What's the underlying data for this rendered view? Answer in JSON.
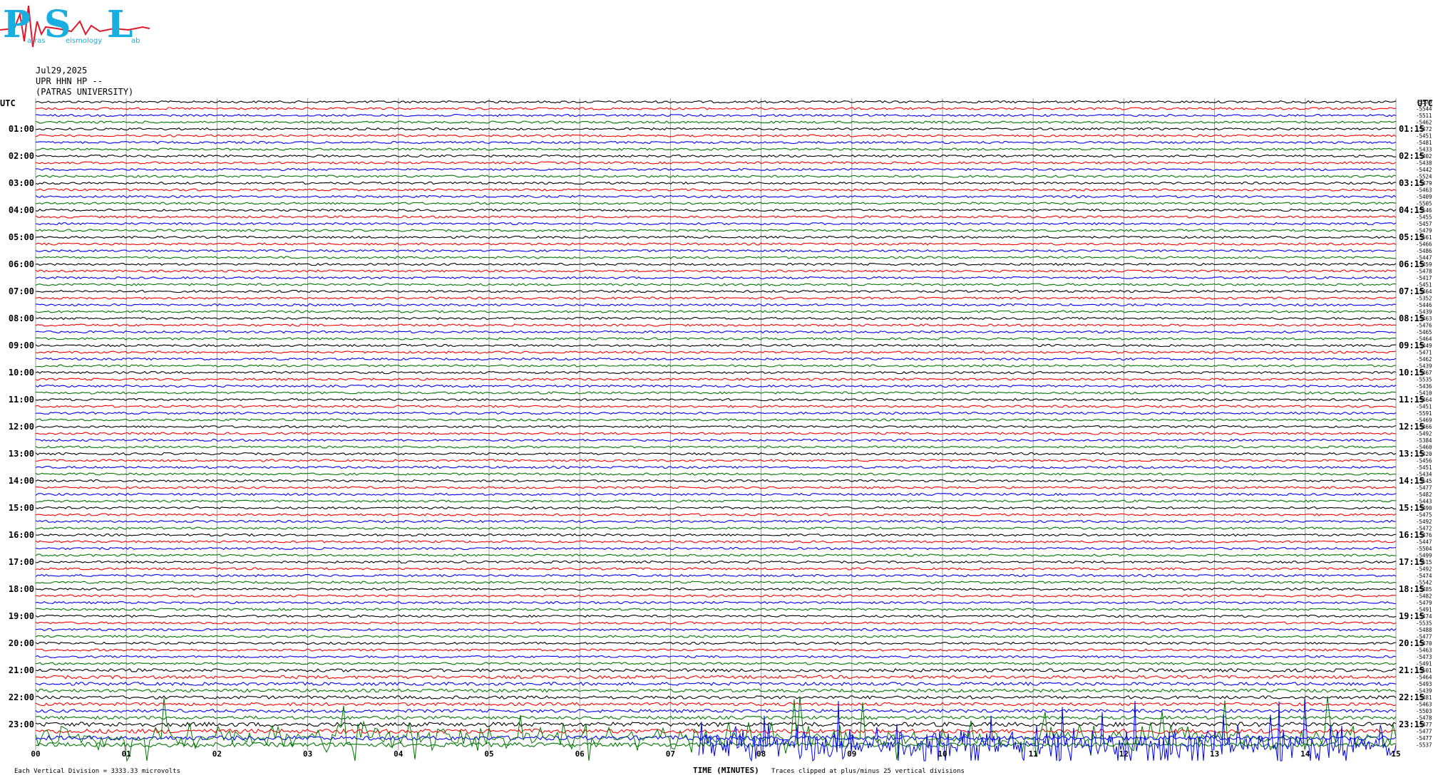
{
  "logo": {
    "letters": [
      "P",
      "S",
      "L"
    ],
    "words": [
      "atras",
      "eismology",
      "ab"
    ],
    "colors": {
      "main": "#19aee0",
      "trace": "#e0182b"
    }
  },
  "header": {
    "date": "Jul29,2025",
    "station": "UPR HHN HP --",
    "institution": "(PATRAS UNIVERSITY)"
  },
  "utc_label": "UTC",
  "left_time_labels": [
    "01:00",
    "02:00",
    "03:00",
    "04:00",
    "05:00",
    "06:00",
    "07:00",
    "08:00",
    "09:00",
    "10:00",
    "11:00",
    "12:00",
    "13:00",
    "14:00",
    "15:00",
    "16:00",
    "17:00",
    "18:00",
    "19:00",
    "20:00",
    "21:00",
    "22:00",
    "23:00"
  ],
  "right_time_labels": [
    "01:15",
    "02:15",
    "03:15",
    "04:15",
    "05:15",
    "06:15",
    "07:15",
    "08:15",
    "09:15",
    "10:15",
    "11:15",
    "12:15",
    "13:15",
    "14:15",
    "15:15",
    "16:15",
    "17:15",
    "18:15",
    "19:15",
    "20:15",
    "21:15",
    "22:15",
    "23:15"
  ],
  "minute_ticks": [
    "00",
    "01",
    "02",
    "03",
    "04",
    "05",
    "06",
    "07",
    "08",
    "09",
    "10",
    "11",
    "12",
    "13",
    "14",
    "15"
  ],
  "x_axis_label": "TIME (MINUTES)",
  "footer_left": "Each Vertical Division = 3333.33 microvolts",
  "footer_right": "Traces clipped at plus/minus 25 vertical divisions",
  "trace_colors": [
    "#000000",
    "#ff0000",
    "#0000ff",
    "#007700"
  ],
  "trace_offsets": [
    "-5579",
    "-5544",
    "-5511",
    "-5462",
    "-5472",
    "-5451",
    "-5481",
    "-5433",
    "-5402",
    "-5438",
    "-5442",
    "-5524",
    "-5479",
    "-5463",
    "-5409",
    "-5505",
    "-5546",
    "-5455",
    "-5457",
    "-5479",
    "-5561",
    "-5466",
    "-5486",
    "-5447",
    "-5459",
    "-5478",
    "-5417",
    "-5451",
    "-5464",
    "-5352",
    "-5446",
    "-5439",
    "-5463",
    "-5476",
    "-5465",
    "-5464",
    "-5449",
    "-5471",
    "-5462",
    "-5439",
    "-5467",
    "-5535",
    "-5436",
    "-5410",
    "-5464",
    "-5451",
    "-5591",
    "-5469",
    "-5466",
    "-5492",
    "-5384",
    "-5460",
    "-5420",
    "-5456",
    "-5451",
    "-5434",
    "-5545",
    "-5477",
    "-5482",
    "-5443",
    "-5490",
    "-5475",
    "-5492",
    "-5472",
    "-5476",
    "-5447",
    "-5504",
    "-5499",
    "-5515",
    "-5492",
    "-5474",
    "-5542",
    "-5485",
    "-5482",
    "-5479",
    "-5491",
    "-5474",
    "-5535",
    "-5488",
    "-5477",
    "-5470",
    "-5463",
    "-5473",
    "-5491",
    "-5501",
    "-5464",
    "-5493",
    "-5439",
    "-5481",
    "-5463",
    "-5503",
    "-5478",
    "-5477",
    "-5477",
    "-5477",
    "-5537"
  ]
}
